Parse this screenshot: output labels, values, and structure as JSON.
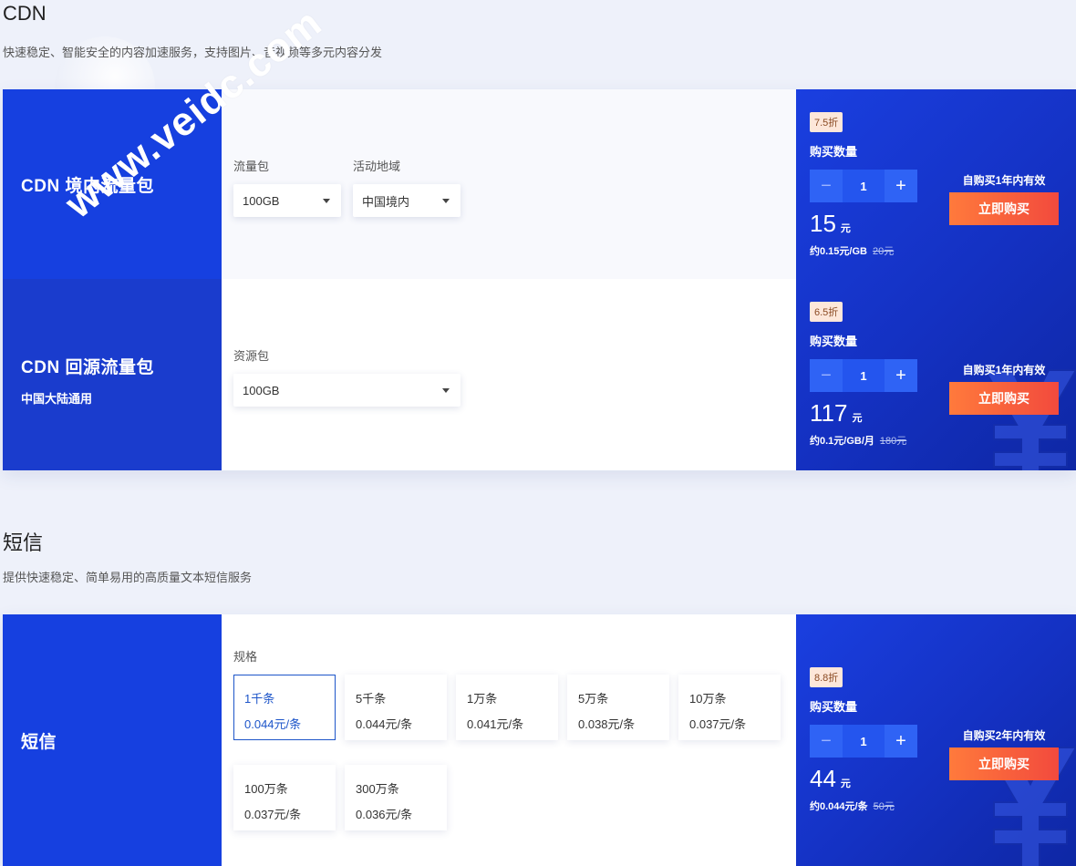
{
  "cdn": {
    "title": "CDN",
    "desc": "快速稳定、智能安全的内容加速服务，支持图片、音视频等多元内容分发",
    "domestic": {
      "name": "CDN 境内流量包",
      "field1_label": "流量包",
      "field1_value": "100GB",
      "field2_label": "活动地域",
      "field2_value": "中国境内",
      "discount": "7.5折",
      "qty_label": "购买数量",
      "qty": "1",
      "price": "15",
      "price_unit": "元",
      "unit_price": "约0.15元/GB",
      "orig_price": "20元",
      "validity": "自购买1年内有效",
      "buy": "立即购买"
    },
    "origin": {
      "name": "CDN 回源流量包",
      "sub": "中国大陆通用",
      "field1_label": "资源包",
      "field1_value": "100GB",
      "discount": "6.5折",
      "qty_label": "购买数量",
      "qty": "1",
      "price": "117",
      "price_unit": "元",
      "unit_price": "约0.1元/GB/月",
      "orig_price": "180元",
      "validity": "自购买1年内有效",
      "buy": "立即购买"
    }
  },
  "sms": {
    "title": "短信",
    "desc": "提供快速稳定、简单易用的高质量文本短信服务",
    "name": "短信",
    "spec_label": "规格",
    "specs": [
      {
        "count": "1千条",
        "price": "0.044元/条"
      },
      {
        "count": "5千条",
        "price": "0.044元/条"
      },
      {
        "count": "1万条",
        "price": "0.041元/条"
      },
      {
        "count": "5万条",
        "price": "0.038元/条"
      },
      {
        "count": "10万条",
        "price": "0.037元/条"
      },
      {
        "count": "100万条",
        "price": "0.037元/条"
      },
      {
        "count": "300万条",
        "price": "0.036元/条"
      }
    ],
    "discount": "8.8折",
    "qty_label": "购买数量",
    "qty": "1",
    "price": "44",
    "price_unit": "元",
    "unit_price": "约0.044元/条",
    "orig_price": "50元",
    "validity": "自购买2年内有效",
    "buy": "立即购买"
  },
  "icons": {
    "minus": "−",
    "plus": "+"
  },
  "watermark": "www.veidc.com"
}
